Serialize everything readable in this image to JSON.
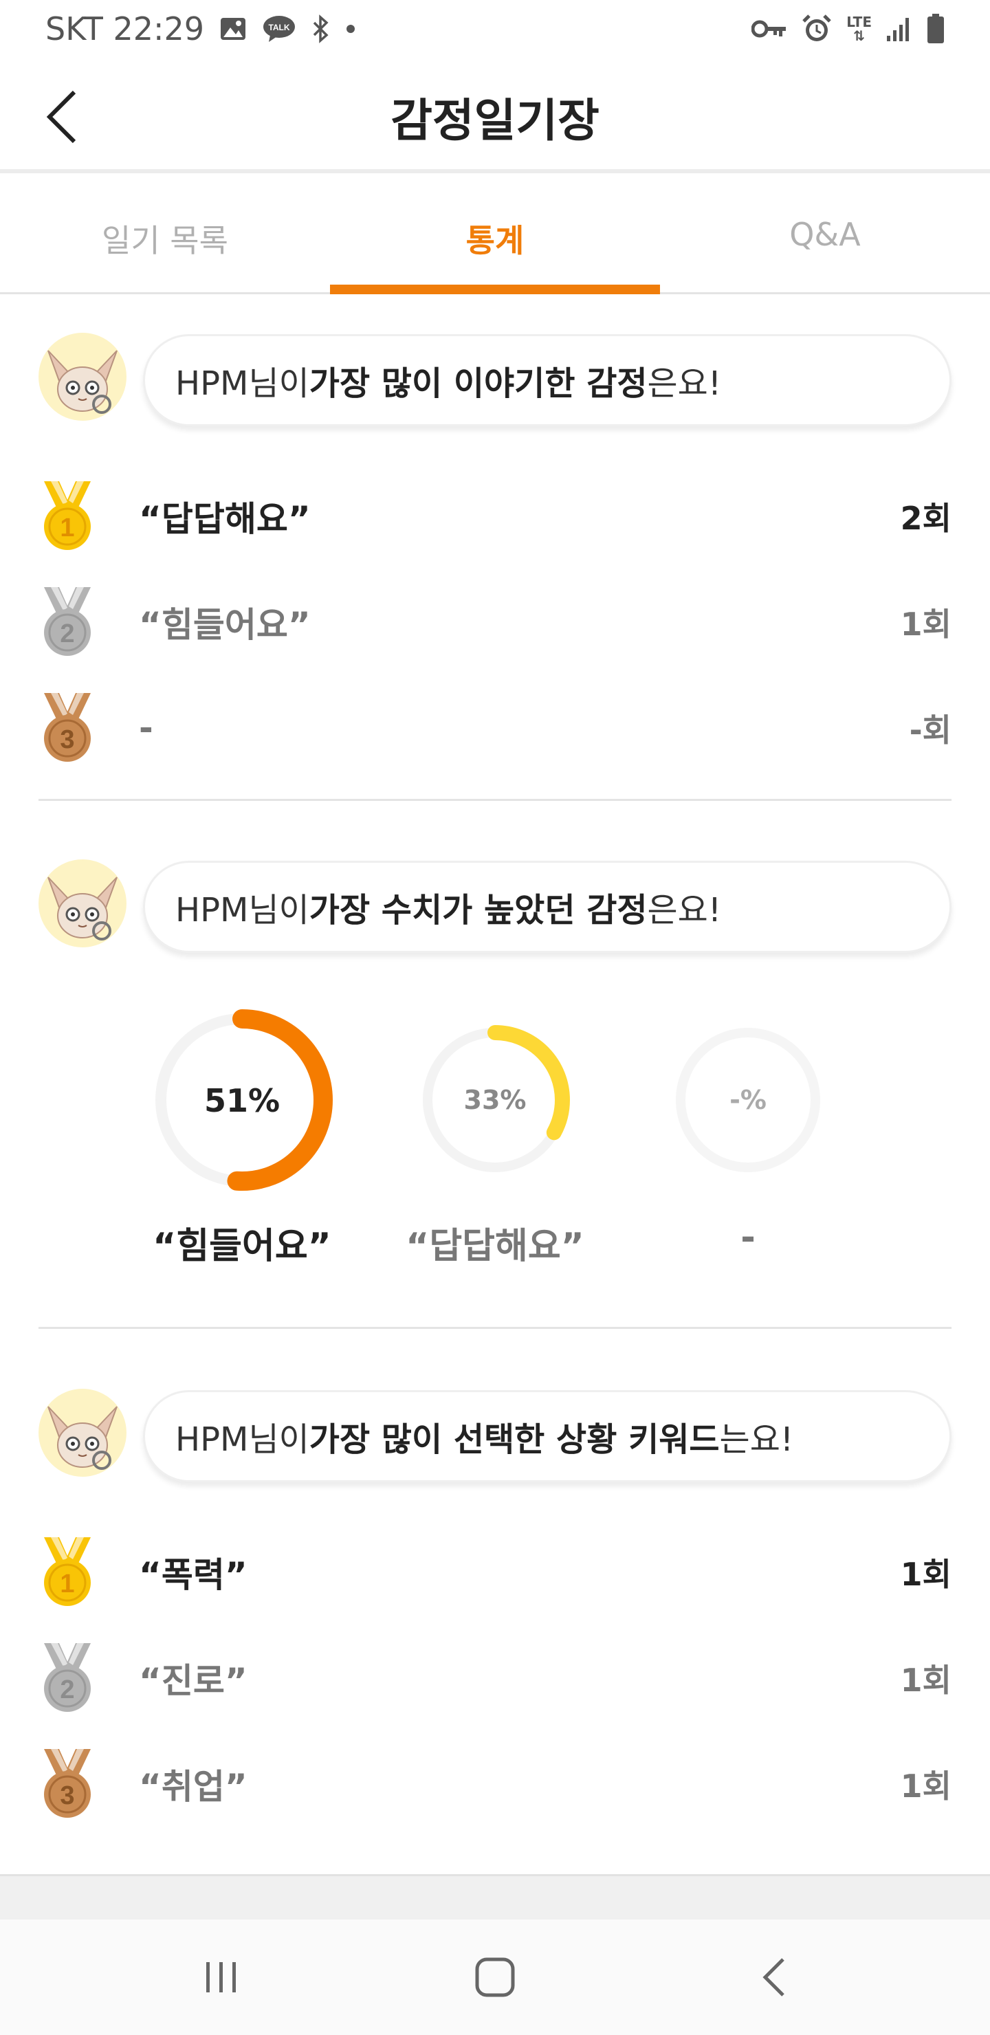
{
  "status_bar": {
    "carrier_time": "SKT 22:29",
    "network": "LTE",
    "icons": [
      "gallery-icon",
      "talk-icon",
      "bluetooth-icon",
      "dot-icon",
      "key-icon",
      "alarm-icon",
      "signal-icon",
      "battery-icon"
    ]
  },
  "header": {
    "title": "감정일기장"
  },
  "tabs": [
    {
      "label": "일기 목록"
    },
    {
      "label": "통계"
    },
    {
      "label": "Q&A"
    }
  ],
  "sections": {
    "most_talked": {
      "prefix": "HPM님이 ",
      "bold": "가장 많이 이야기한 감정",
      "suffix": "은요!",
      "ranks": [
        {
          "label": "“답답해요”",
          "count": "2회"
        },
        {
          "label": "“힘들어요”",
          "count": "1회"
        },
        {
          "label": "-",
          "count": "-회"
        }
      ]
    },
    "highest_value": {
      "prefix": "HPM님이 ",
      "bold": "가장 수치가 높았던 감정",
      "suffix": "은요!",
      "donuts": [
        {
          "pct_label": "51%",
          "pct": 51,
          "name": "“힘들어요”",
          "color": "#f57c00"
        },
        {
          "pct_label": "33%",
          "pct": 33,
          "name": "“답답해요”",
          "color": "#fdd835"
        },
        {
          "pct_label": "-%",
          "pct": 0,
          "name": "-",
          "color": "#eeeeee"
        }
      ]
    },
    "most_keywords": {
      "prefix": "HPM님이 ",
      "bold": "가장 많이 선택한 상황 키워드",
      "suffix": "는요!",
      "ranks": [
        {
          "label": "“폭력”",
          "count": "1회"
        },
        {
          "label": "“진로”",
          "count": "1회"
        },
        {
          "label": "“취업”",
          "count": "1회"
        }
      ]
    }
  },
  "medals": [
    "1",
    "2",
    "3"
  ],
  "colors": {
    "accent": "#f07d0a",
    "gold": "#f9c406",
    "silver": "#b3b3b3",
    "bronze": "#c98a52"
  }
}
